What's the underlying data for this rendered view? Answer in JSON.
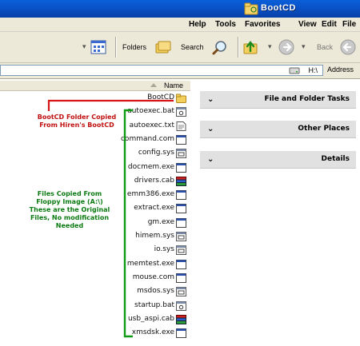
{
  "window": {
    "title": "BootCD"
  },
  "menu": [
    "File",
    "Edit",
    "View",
    "Favorites",
    "Tools",
    "Help"
  ],
  "toolbar": {
    "back_label": "Back",
    "search_label": "Search",
    "folders_label": "Folders"
  },
  "address": {
    "label": "Address",
    "value": "H:\\"
  },
  "list": {
    "column_name": "Name",
    "files": [
      {
        "name": "BootCD",
        "icon": "folder-icon"
      },
      {
        "name": "autoexec.bat",
        "icon": "batch-file-icon"
      },
      {
        "name": "autoexec.txt",
        "icon": "text-file-icon"
      },
      {
        "name": "command.com",
        "icon": "application-icon"
      },
      {
        "name": "config.sys",
        "icon": "system-file-icon"
      },
      {
        "name": "docmem.exe",
        "icon": "application-icon"
      },
      {
        "name": "drivers.cab",
        "icon": "cabinet-icon"
      },
      {
        "name": "emm386.exe",
        "icon": "application-icon"
      },
      {
        "name": "extract.exe",
        "icon": "application-icon"
      },
      {
        "name": "gm.exe",
        "icon": "application-icon"
      },
      {
        "name": "himem.sys",
        "icon": "system-file-icon"
      },
      {
        "name": "io.sys",
        "icon": "system-file-icon"
      },
      {
        "name": "memtest.exe",
        "icon": "application-icon"
      },
      {
        "name": "mouse.com",
        "icon": "application-icon"
      },
      {
        "name": "msdos.sys",
        "icon": "system-file-icon"
      },
      {
        "name": "startup.bat",
        "icon": "batch-file-icon"
      },
      {
        "name": "usb_aspi.cab",
        "icon": "cabinet-icon"
      },
      {
        "name": "xmsdsk.exe",
        "icon": "application-icon"
      }
    ]
  },
  "annotations": {
    "red": [
      "BootCD Folder Copied",
      "From Hiren's BootCD"
    ],
    "green": [
      "Files Copied From",
      "Floppy Image  (A:\\)",
      "These are the Original",
      "Files, No modification",
      "Needed"
    ]
  },
  "taskpane": [
    "File and Folder Tasks",
    "Other Places",
    "Details"
  ],
  "colors": {
    "title_bar": "#0a52c8",
    "annotation_red": "#c01010",
    "annotation_green": "#0b7a12",
    "chrome": "#ece9d8"
  }
}
